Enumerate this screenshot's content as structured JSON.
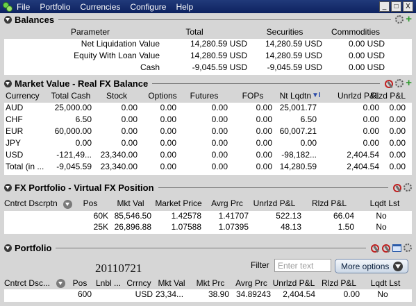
{
  "menubar": {
    "items": [
      "File",
      "Portfolio",
      "Currencies",
      "Configure",
      "Help"
    ],
    "window_controls": [
      "_",
      "□",
      "X"
    ]
  },
  "balances": {
    "title": "Balances",
    "headers": [
      "Parameter",
      "Total",
      "Securities",
      "Commodities"
    ],
    "rows": [
      [
        "Net Liquidation Value",
        "14,280.59 USD",
        "14,280.59 USD",
        "0.00 USD"
      ],
      [
        "Equity With Loan Value",
        "14,280.59 USD",
        "14,280.59 USD",
        "0.00 USD"
      ],
      [
        "Cash",
        "-9,045.59 USD",
        "-9,045.59 USD",
        "0.00 USD"
      ]
    ]
  },
  "market_value": {
    "title": "Market Value - Real FX Balance",
    "headers": [
      "Currency",
      "Total Cash",
      "Stock",
      "Options",
      "Futures",
      "FOPs",
      "Nt Lqdtn",
      "Unrlzd P&L",
      "Rlzd P&L"
    ],
    "sort_indicator": "▼I",
    "rows": [
      [
        "AUD",
        "25,000.00",
        "0.00",
        "0.00",
        "0.00",
        "0.00",
        "25,001.77",
        "0.00",
        "0.00"
      ],
      [
        "CHF",
        "6.50",
        "0.00",
        "0.00",
        "0.00",
        "0.00",
        "6.50",
        "0.00",
        "0.00"
      ],
      [
        "EUR",
        "60,000.00",
        "0.00",
        "0.00",
        "0.00",
        "0.00",
        "60,007.21",
        "0.00",
        "0.00"
      ],
      [
        "JPY",
        "0.00",
        "0.00",
        "0.00",
        "0.00",
        "0.00",
        "0.00",
        "0.00",
        "0.00"
      ],
      [
        "USD",
        "-121,49...",
        "23,340.00",
        "0.00",
        "0.00",
        "0.00",
        "-98,182...",
        "2,404.54",
        "0.00"
      ],
      [
        "Total (in ...",
        "-9,045.59",
        "23,340.00",
        "0.00",
        "0.00",
        "0.00",
        "14,280.59",
        "2,404.54",
        "0.00"
      ]
    ]
  },
  "fx_portfolio": {
    "title": "FX Portfolio - Virtual FX Position",
    "headers": [
      "Cntrct Dscrptn",
      "Pos",
      "Mkt Val",
      "Market Price",
      "Avrg Prc",
      "Unrlzd P&L",
      "Rlzd P&L",
      "Lqdt Lst"
    ],
    "rows": [
      [
        "",
        "60K",
        "85,546.50",
        "1.42578",
        "1.41707",
        "522.13",
        "66.04",
        "No"
      ],
      [
        "",
        "25K",
        "26,896.88",
        "1.07588",
        "1.07395",
        "48.13",
        "1.50",
        "No"
      ]
    ]
  },
  "portfolio": {
    "title": "Portfolio",
    "filter_label": "Filter",
    "filter_placeholder": "Enter text",
    "more_options_label": "More options",
    "date_stamp": "20110721",
    "headers": [
      "Cntrct Dsc...",
      "Pos",
      "Lnbl ...",
      "Crrncy",
      "Mkt Val",
      "Mkt Prc",
      "Avrg Prc",
      "Unrlzd P&L",
      "Rlzd P&L",
      "Lqdt Lst"
    ],
    "rows": [
      [
        "",
        "600",
        "",
        "USD",
        "23,34...",
        "38.90",
        "34.89243",
        "2,404.54",
        "0.00",
        "No"
      ]
    ]
  }
}
